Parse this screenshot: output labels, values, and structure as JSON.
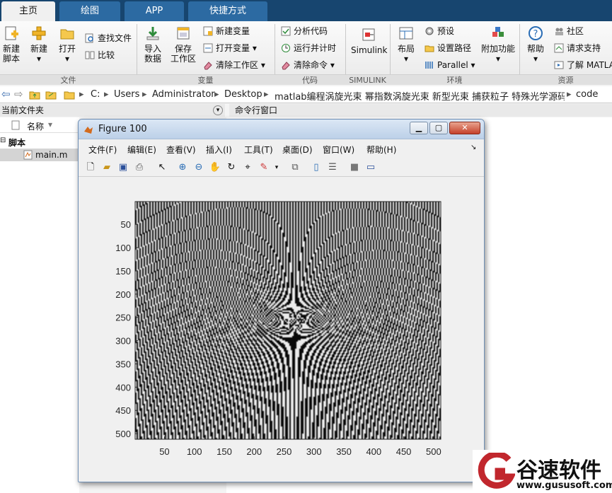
{
  "tabs": [
    {
      "label": "主页",
      "active": true
    },
    {
      "label": "绘图",
      "active": false
    },
    {
      "label": "APP",
      "active": false
    },
    {
      "label": "快捷方式",
      "active": false
    }
  ],
  "ribbon": {
    "file_group": "文件",
    "var_group": "变量",
    "code_group": "代码",
    "simulink_group": "SIMULINK",
    "env_group": "环境",
    "res_group": "资源",
    "new_script": [
      "新建",
      "脚本"
    ],
    "new": "新建",
    "open": "打开",
    "find_files": "查找文件",
    "compare": "比较",
    "import": [
      "导入",
      "数据"
    ],
    "save_ws": [
      "保存",
      "工作区"
    ],
    "new_var": "新建变量",
    "open_var": "打开变量",
    "clear_ws": "清除工作区",
    "analyze": "分析代码",
    "run_time": "运行并计时",
    "clear_cmd": "清除命令",
    "simulink": "Simulink",
    "layout": "布局",
    "preferences": "预设",
    "set_path": "设置路径",
    "parallel": "Parallel",
    "addons": "附加功能",
    "help": "帮助",
    "community": "社区",
    "support": "请求支持",
    "learn": "了解 MATLAB"
  },
  "address": {
    "segments": [
      "C:",
      "Users",
      "Administrator",
      "Desktop",
      "matlab编程涡旋光束 幂指数涡旋光束 新型光束 捕获粒子 特殊光学源码程序",
      "code"
    ]
  },
  "panels": {
    "current_folder": "当前文件夹",
    "command_window": "命令行窗口",
    "name_col": "名称",
    "section": "脚本",
    "file": "main.m"
  },
  "figure": {
    "title": "Figure 100",
    "menus": [
      "文件(F)",
      "编辑(E)",
      "查看(V)",
      "插入(I)",
      "工具(T)",
      "桌面(D)",
      "窗口(W)",
      "帮助(H)"
    ]
  },
  "chart_data": {
    "type": "heatmap",
    "description_units": "image of a fork/vortex interference pattern, 512x512 pixels, black/white",
    "xlim": [
      1,
      512
    ],
    "ylim": [
      1,
      512
    ],
    "yticks": [
      50,
      100,
      150,
      200,
      250,
      300,
      350,
      400,
      450,
      500
    ],
    "xticks": [
      50,
      100,
      150,
      200,
      250,
      300,
      350,
      400,
      450,
      500
    ],
    "colormap": "gray",
    "grid": false
  },
  "watermark": {
    "brand": "谷速软件",
    "url": "www.gususoft.com",
    "color": "#c1272d"
  }
}
